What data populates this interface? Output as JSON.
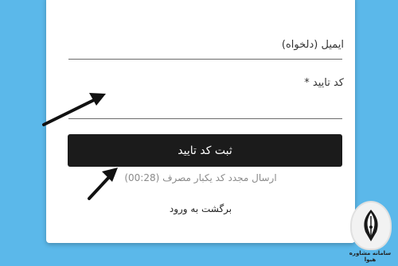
{
  "form": {
    "email_label": "ایمیل (دلخواه)",
    "code_label": "کد تایید *",
    "code_value": "",
    "submit_label": "ثبت کد تایید",
    "resend_text": "ارسال مجدد کد یکبار مصرف (00:28)",
    "back_link": "برگشت به ورود"
  },
  "watermark": {
    "brand_text": "سامانه مشاوره هیوا"
  },
  "colors": {
    "background": "#5bb8ea",
    "button": "#1b1b1b",
    "arrow": "#111111"
  }
}
